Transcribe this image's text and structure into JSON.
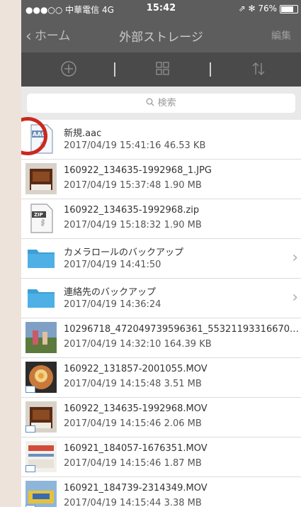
{
  "status_bar": {
    "carrier": "●●●○○ 中華電信 4G",
    "time": "15:42",
    "right": "⇗ ✻ 76%"
  },
  "nav": {
    "back_label": "ホーム",
    "title": "外部ストレージ",
    "edit_label": "編集"
  },
  "toolbar": {
    "icons": [
      "add-icon",
      "grid-view-icon",
      "sort-icon"
    ]
  },
  "search": {
    "placeholder": "検索"
  },
  "files": [
    {
      "name": "新規.aac",
      "meta": "2017/04/19 15:41:16  46.53 KB",
      "kind": "aac"
    },
    {
      "name": "160922_134635-1992968_1.JPG",
      "meta": "2017/04/19 15:37:48  1.90 MB",
      "kind": "photo"
    },
    {
      "name": "160922_134635-1992968.zip",
      "meta": "2017/04/19 15:18:32  1.90 MB",
      "kind": "zip"
    },
    {
      "name": "カメラロールのバックアップ",
      "meta": "2017/04/19 14:41:50",
      "kind": "folder"
    },
    {
      "name": "連絡先のバックアップ",
      "meta": "2017/04/19 14:36:24",
      "kind": "folder"
    },
    {
      "name": "10296718_472049739596361_55321193316670…",
      "meta": "2017/04/19 14:32:10  164.39 KB",
      "kind": "photo"
    },
    {
      "name": "160922_131857-2001055.MOV",
      "meta": "2017/04/19 14:15:48  3.51 MB",
      "kind": "video"
    },
    {
      "name": "160922_134635-1992968.MOV",
      "meta": "2017/04/19 14:15:46  2.06 MB",
      "kind": "video"
    },
    {
      "name": "160921_184057-1676351.MOV",
      "meta": "2017/04/19 14:15:46  1.87 MB",
      "kind": "video"
    },
    {
      "name": "160921_184739-2314349.MOV",
      "meta": "2017/04/19 14:15:44  3.38 MB",
      "kind": "video"
    }
  ],
  "file_icon_labels": {
    "aac": "AAC",
    "zip": "ZIP"
  },
  "colors": {
    "navbar": "#5d5d5d",
    "toolbar": "#4a4a4a",
    "folder": "#3d9fd7",
    "highlight_circle": "#c9291f"
  }
}
